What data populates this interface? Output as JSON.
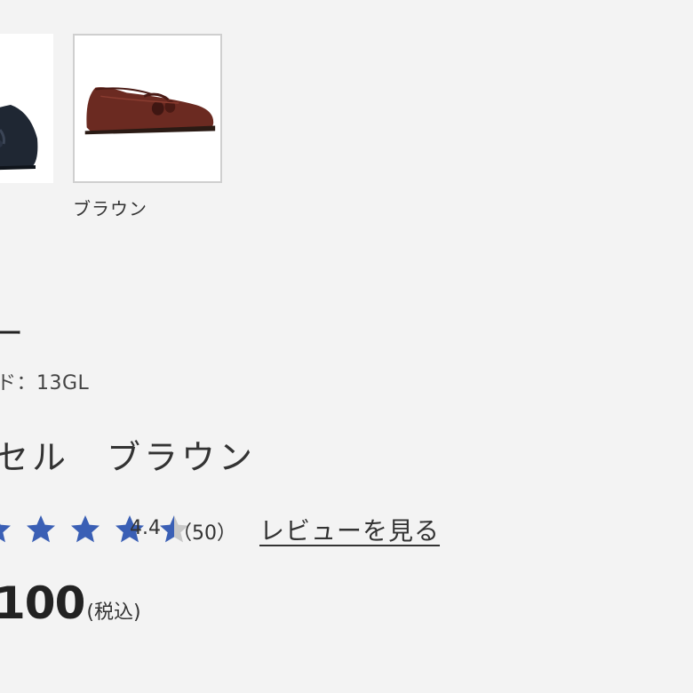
{
  "color_options": [
    {
      "name": "black-shoe-swatch"
    },
    {
      "label": "ブラウン",
      "selected": true
    }
  ],
  "product": {
    "title_fragment": "ー",
    "model_code": "ド：13GL",
    "name": "セル　ブラウン"
  },
  "rating": {
    "value": "4.4",
    "count": "（50）",
    "stars": 4.5,
    "star_color": "#3a5fb5",
    "empty_star_color": "#c8c8c8",
    "review_link_label": "レビューを見る"
  },
  "price": {
    "amount": "100",
    "tax_note": "(税込)"
  }
}
